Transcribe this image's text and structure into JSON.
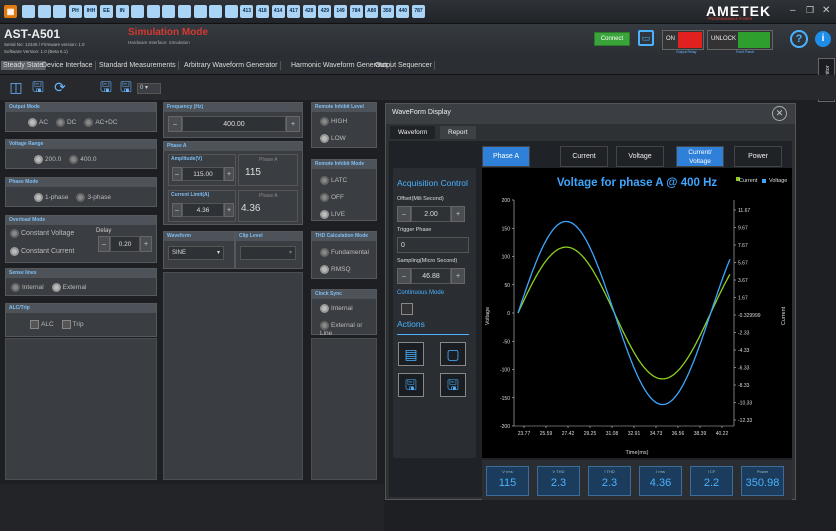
{
  "window": {
    "title": "AST-A501",
    "serial": "Serial No: 12345 / Firmware version: 1.0",
    "software": "Software Version: 1.0 (Beta 6.1)",
    "mode": "Simulation Mode",
    "mode_sub": "Hardware Interface: Simulation"
  },
  "brand": {
    "name": "AMETEK",
    "sub": "PROGRAMMABLE POWER"
  },
  "header": {
    "connect": "Connect",
    "on": "ON",
    "unlock": "UNLOCK",
    "output_relay": "Output Relay",
    "front_panel": "Front Panel"
  },
  "toolbar_icons": [
    "grid-icon",
    "cmd1",
    "cmd2",
    "cmd3",
    "cmd4",
    "cmd5",
    "cmd6",
    "cmd7",
    "cmd8",
    "cmd9",
    "cmd10",
    "cmd11",
    "cmd12",
    "cmd13",
    "cmd14",
    "cmd15",
    "cmd16",
    "cmd17",
    "cmd18",
    "cmd19",
    "cmd20",
    "cmd21",
    "cmd22",
    "cmd23",
    "cmd24",
    "cmd25"
  ],
  "toolbar_labels": [
    "",
    "",
    "",
    "",
    "PH",
    "IHH",
    "EE",
    "IN",
    "",
    "",
    "",
    "",
    "",
    "",
    "",
    "413",
    "418",
    "414",
    "417",
    "428",
    "429",
    "149",
    "784",
    "A80",
    "350",
    "440",
    "787"
  ],
  "tabs": [
    "Steady State",
    "Device Interface",
    "Standard Measurements",
    "Arbitrary Waveform Generator",
    "Harmonic Waveform Generator",
    "Output Sequencer"
  ],
  "bus_monitor": "Bus Monitor",
  "steady": {
    "output_mode": {
      "title": "Output Mode",
      "options": [
        "AC",
        "DC",
        "AC+DC"
      ]
    },
    "voltage_range": {
      "title": "Voltage Range",
      "options": [
        "200.0",
        "400.0"
      ]
    },
    "phase_mode": {
      "title": "Phase Mode",
      "options": [
        "1-phase",
        "3-phase"
      ]
    },
    "overload": {
      "title": "Overload Mode",
      "options": [
        "Constant Voltage",
        "Constant Current"
      ],
      "delay_label": "Delay",
      "delay": "0.20"
    },
    "sense": {
      "title": "Sense lines",
      "options": [
        "Internal",
        "External"
      ]
    },
    "alc": {
      "title": "ALC/Trip",
      "options": [
        "ALC",
        "Trip"
      ]
    },
    "frequency": {
      "title": "Frequency (Hz)",
      "value": "400.00"
    },
    "phase_a": {
      "title": "Phase A",
      "amp_label": "Amplitude(V)",
      "amp": "115.00",
      "phase_a": "Phase A",
      "amp_read": "115",
      "cur_label": "Current Limit(A)",
      "cur": "4.36",
      "cur_read": "4.36"
    },
    "waveform": {
      "title": "Waveform",
      "value": "SINE",
      "clip": "Clip Level"
    },
    "remote_level": {
      "title": "Remote Inhibit Level",
      "options": [
        "HIGH",
        "LOW"
      ]
    },
    "remote_mode": {
      "title": "Remote Inhibit Mode",
      "options": [
        "LATC",
        "OFF",
        "LIVE"
      ]
    },
    "thd": {
      "title": "THD Calculation Mode",
      "options": [
        "Fundamental",
        "RMSQ"
      ]
    },
    "clock": {
      "title": "Clock Sync",
      "options": [
        "Internal",
        "External or Line"
      ]
    }
  },
  "wave": {
    "title": "WaveForm Display",
    "tabs": [
      "Waveform",
      "Report"
    ],
    "segments": [
      "Phase A",
      "Current",
      "Voltage",
      "Current/ Voltage",
      "Power"
    ],
    "acq": "Acquisition Control",
    "offset_label": "Offset(Mili Second)",
    "offset": "2.00",
    "trigger_label": "Trigger Phase",
    "trigger": "0",
    "sampling_label": "Sampling(Micro Second)",
    "sampling": "46.88",
    "continuous": "Continuous Mode",
    "actions": "Actions",
    "meters": [
      {
        "label": "V rms",
        "value": "115"
      },
      {
        "label": "V THD",
        "value": "2.3"
      },
      {
        "label": "I THD",
        "value": "2.3"
      },
      {
        "label": "I rms",
        "value": "4.36"
      },
      {
        "label": "I CF",
        "value": "2.2"
      },
      {
        "label": "Power",
        "value": "350.98"
      }
    ]
  },
  "chart_data": {
    "type": "line",
    "title": "Voltage for phase A @ 400 Hz",
    "legend": [
      "Current",
      "Voltage"
    ],
    "xlabel": "Time(ms)",
    "ylabel": "Voltage",
    "y2label": "Current",
    "x_ticks": [
      "23.77",
      "25.59",
      "27.42",
      "29.25",
      "31.08",
      "32.91",
      "34.73",
      "36.56",
      "38.39",
      "40.22"
    ],
    "y_ticks": [
      "200",
      "150",
      "100",
      "50",
      "0",
      "-50",
      "-100",
      "-150",
      "-200"
    ],
    "y2_ticks": [
      "11.67",
      "9.67",
      "7.67",
      "5.67",
      "3.67",
      "1.67",
      "-0.329999",
      "-2.33",
      "-4.33",
      "-6.33",
      "-8.33",
      "-10.33",
      "-12.33"
    ],
    "ylim": [
      -200,
      200
    ],
    "series": [
      {
        "name": "Voltage",
        "amplitude": 162,
        "color": "#3ea6ff"
      },
      {
        "name": "Current",
        "amplitude": 6.2,
        "color": "#8fcf20"
      }
    ],
    "colors": {
      "voltage": "#3ea6ff",
      "current": "#8fcf20"
    }
  }
}
